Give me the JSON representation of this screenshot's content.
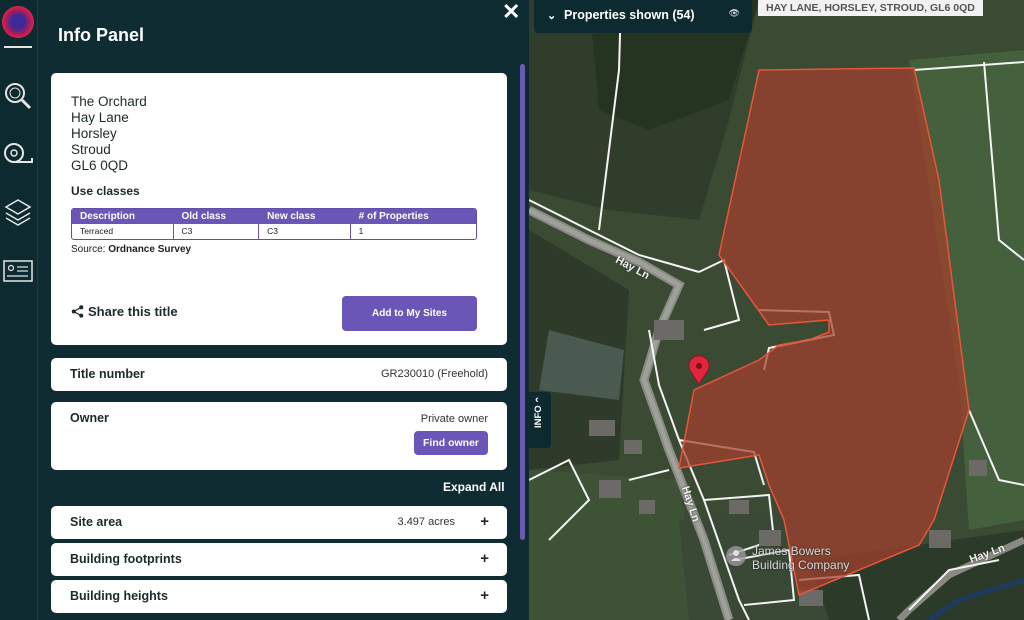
{
  "panel": {
    "title": "Info Panel",
    "close": "✕"
  },
  "address": {
    "line1": "The Orchard",
    "line2": "Hay Lane",
    "line3": "Horsley",
    "line4": "Stroud",
    "line5": "GL6 0QD"
  },
  "use_classes": {
    "heading": "Use classes",
    "columns": [
      "Description",
      "Old class",
      "New class",
      "# of Properties"
    ],
    "row": [
      "Terraced",
      "C3",
      "C3",
      "1"
    ]
  },
  "source": {
    "prefix": "Source: ",
    "name": "Ordnance Survey"
  },
  "share_label": "Share this title",
  "add_sites_label": "Add to My Sites",
  "title_number": {
    "label": "Title number",
    "value": "GR230010 (Freehold)"
  },
  "owner": {
    "label": "Owner",
    "status": "Private owner",
    "button": "Find owner"
  },
  "expand_all": "Expand All",
  "sections": [
    {
      "label": "Site area",
      "value": "3.497 acres"
    },
    {
      "label": "Building footprints",
      "value": ""
    },
    {
      "label": "Building heights",
      "value": ""
    }
  ],
  "map": {
    "properties_label": "Properties shown (54)",
    "address_strip": "HAY LANE, HORSLEY, STROUD, GL6 0QD",
    "info_tab": "INFO",
    "road_labels": [
      "Hay Ln",
      "Hay Ln",
      "Hay Ln"
    ],
    "poi": {
      "line1": "James Bowers",
      "line2": "Building Company"
    }
  },
  "colors": {
    "panel_bg": "#0e2c32",
    "accent": "#6a56b6",
    "parcel": "#a4402c",
    "marker": "#e0263a"
  }
}
